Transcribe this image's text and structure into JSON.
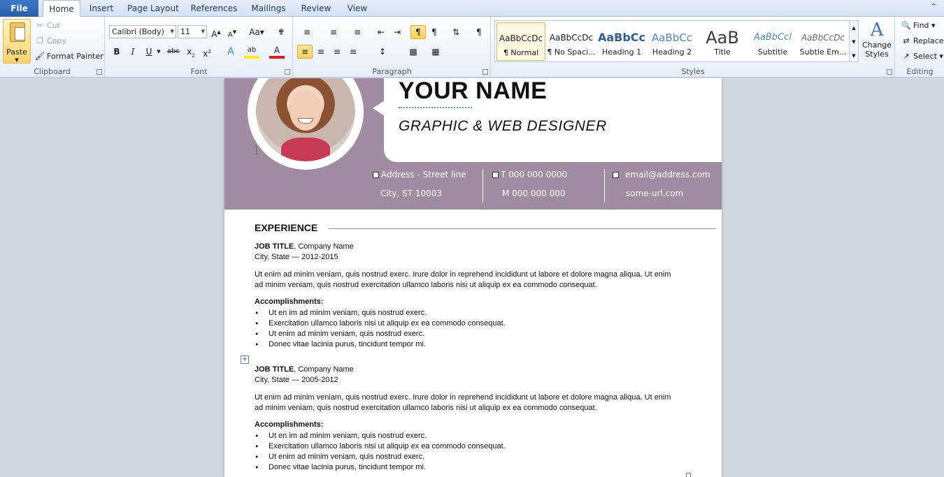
{
  "tabs": {
    "file": "File",
    "home": "Home",
    "insert": "Insert",
    "page_layout": "Page Layout",
    "references": "References",
    "mailings": "Mailings",
    "review": "Review",
    "view": "View"
  },
  "clipboard": {
    "paste": "Paste",
    "cut": "Cut",
    "copy": "Copy",
    "format_painter": "Format Painter",
    "label": "Clipboard"
  },
  "font": {
    "family": "Calibri (Body)",
    "size": "11",
    "label": "Font"
  },
  "paragraph": {
    "label": "Paragraph"
  },
  "styles": {
    "label": "Styles",
    "tiles": [
      {
        "preview": "AaBbCcDc",
        "name": "¶ Normal"
      },
      {
        "preview": "AaBbCcDc",
        "name": "¶ No Spaci..."
      },
      {
        "preview": "AaBbCc",
        "name": "Heading 1"
      },
      {
        "preview": "AaBbCc",
        "name": "Heading 2"
      },
      {
        "preview": "AaB",
        "name": "Title"
      },
      {
        "preview": "AaBbCcl",
        "name": "Subtitle"
      },
      {
        "preview": "AaBbCcDc",
        "name": "Subtle Em..."
      }
    ],
    "change_styles": "Change Styles"
  },
  "editing": {
    "find": "Find",
    "replace": "Replace",
    "select": "Select",
    "label": "Editing"
  },
  "resume": {
    "name": "YOUR NAME",
    "title": "GRAPHIC & WEB DESIGNER",
    "marker": "1",
    "address1": "Address - Street line",
    "address2": "City, ST 10003",
    "phone1": "T 000 000 0000",
    "phone2": "M 000 000 000",
    "email": "email@address.com",
    "url": "some-url.com",
    "section": "EXPERIENCE",
    "jobs": [
      {
        "title": "JOB TITLE",
        "company": ", Company Name",
        "location_dates": "City, State — 2012-2015",
        "desc1": "Ut enim ad minim veniam, quis nostrud exerc. Irure dolor in reprehend incididunt ut labore et dolore magna aliqua. Ut enim",
        "desc2": "ad minim veniam, quis nostrud exercitation ullamco laboris nisi ut aliquip ex ea commodo consequat.",
        "acc_label": "Accomplishments:",
        "bullets": [
          "Ut en im ad minim veniam, quis nostrud exerc.",
          "Exercitation ullamco laboris nisi ut aliquip ex ea commodo consequat.",
          "Ut enim ad minim veniam, quis nostrud exerc.",
          "Donec vitae lacinia purus, tincidunt tempor mi."
        ]
      },
      {
        "title": "JOB TITLE",
        "company": ", Company Name",
        "location_dates": "City, State — 2005-2012",
        "desc1": "Ut enim ad minim veniam, quis nostrud exerc. Irure dolor in reprehend incididunt ut labore et dolore magna aliqua. Ut enim",
        "desc2": "ad minim veniam, quis nostrud exercitation ullamco laboris nisi ut aliquip ex ea commodo consequat.",
        "acc_label": "Accomplishments:",
        "bullets": [
          "Ut en im ad minim veniam, quis nostrud exerc.",
          "Exercitation ullamco laboris nisi ut aliquip ex ea commodo consequat.",
          "Ut enim ad minim veniam, quis nostrud exerc.",
          "Donec vitae lacinia purus, tincidunt tempor mi."
        ]
      }
    ]
  },
  "colors": {
    "banner": "#a08ca0",
    "file_tab": "#2a5ea8"
  }
}
